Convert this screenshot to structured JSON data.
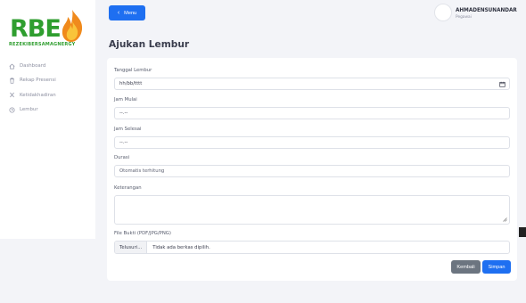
{
  "brand": {
    "logo_text": "RBE",
    "tagline": "REZEKIBERSAMAGNERGY",
    "colors": {
      "green": "#2f9e2f",
      "flame_outer": "#f08a1c",
      "flame_inner": "#f9c43a"
    }
  },
  "sidebar": {
    "items": [
      {
        "label": "Dashboard",
        "icon": "home-icon"
      },
      {
        "label": "Rekap Presensi",
        "icon": "trash-icon"
      },
      {
        "label": "Ketidakhadiran",
        "icon": "x-icon"
      },
      {
        "label": "Lembur",
        "icon": "clock-icon"
      }
    ]
  },
  "topbar": {
    "menu_label": "Menu",
    "user_name": "AHMADENSUNANDAR",
    "user_role": "Pegawai"
  },
  "page": {
    "title": "Ajukan Lembur"
  },
  "form": {
    "tanggal_label": "Tanggal Lembur",
    "tanggal_value": "hh/bb/tttt",
    "jam_mulai_label": "Jam Mulai",
    "jam_mulai_value": "--.--",
    "jam_selesai_label": "Jam Selesai",
    "jam_selesai_value": "--.--",
    "durasi_label": "Durasi",
    "durasi_placeholder": "Otomatis terhitung",
    "keterangan_label": "Keterangan",
    "keterangan_value": "",
    "file_label": "File Bukti (PDF/JPG/PNG)",
    "file_button": "Telusuri...",
    "file_status": "Tidak ada berkas dipilih.",
    "back_label": "Kembali",
    "save_label": "Simpan"
  },
  "colors": {
    "primary": "#1e6ff1",
    "secondary": "#6c7580",
    "background": "#f3f4f8"
  }
}
